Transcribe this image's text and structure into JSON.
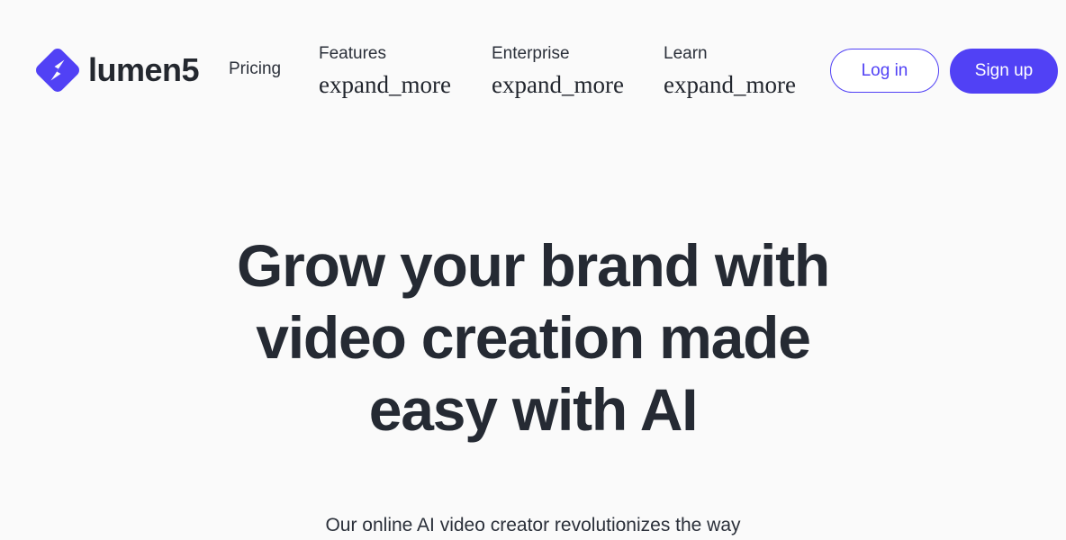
{
  "theme": {
    "background": "#fafafa",
    "accent": "#5141f5",
    "text_dark": "#252a33",
    "text_light": "#ffffff"
  },
  "header": {
    "brand": {
      "logo_icon": "lumen5-diamond-bolt-logo",
      "wordmark": "lumen5"
    },
    "nav": {
      "pricing": "Pricing",
      "dropdowns": [
        {
          "label": "Features",
          "icon_text": "expand_more",
          "icon_name": "expand-more-icon"
        },
        {
          "label": "Enterprise",
          "icon_text": "expand_more",
          "icon_name": "expand-more-icon"
        },
        {
          "label": "Learn",
          "icon_text": "expand_more",
          "icon_name": "expand-more-icon"
        }
      ]
    },
    "actions": {
      "login": "Log in",
      "signup": "Sign up"
    }
  },
  "hero": {
    "title_lines": [
      "Grow your brand with",
      "video creation made",
      "easy with AI"
    ],
    "subtitle": "Our online AI video creator revolutionizes the way"
  }
}
